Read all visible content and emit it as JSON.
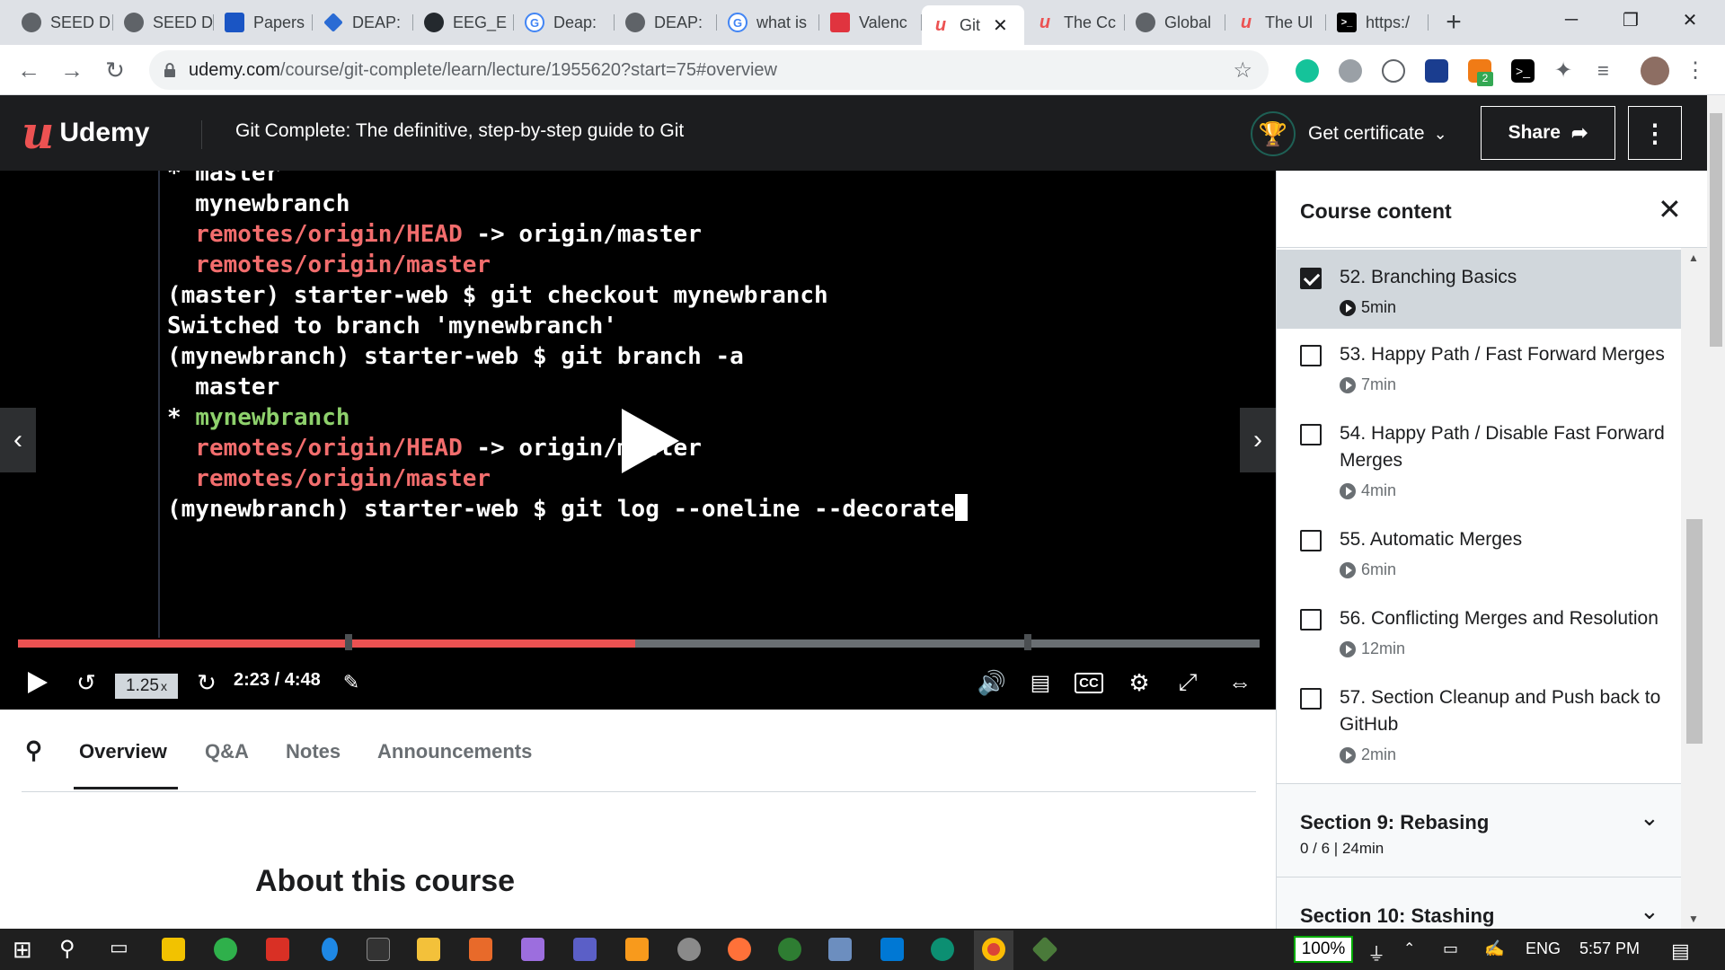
{
  "browser": {
    "tabs": [
      {
        "label": "SEED D",
        "icon": "globe-icon"
      },
      {
        "label": "SEED D",
        "icon": "globe-icon"
      },
      {
        "label": "Papers",
        "icon": "papers-icon"
      },
      {
        "label": "DEAP:",
        "icon": "deap-icon"
      },
      {
        "label": "EEG_E",
        "icon": "github-icon"
      },
      {
        "label": "Deap:",
        "icon": "google-icon"
      },
      {
        "label": "DEAP:",
        "icon": "globe-icon"
      },
      {
        "label": "what is",
        "icon": "google-icon"
      },
      {
        "label": "Valenc",
        "icon": "share-icon"
      },
      {
        "label": "Git",
        "icon": "udemy-icon",
        "active": true
      },
      {
        "label": "The Cc",
        "icon": "udemy-icon"
      },
      {
        "label": "Global",
        "icon": "globe-icon"
      },
      {
        "label": "The Ul",
        "icon": "udemy-icon"
      },
      {
        "label": "https:/",
        "icon": "terminal-icon"
      }
    ],
    "new_tab": "+",
    "url_host": "udemy.com",
    "url_path": "/course/git-complete/learn/lecture/1955620?start=75#overview",
    "extension_badge": "2"
  },
  "header": {
    "logo_letter": "u",
    "logo_word": "Udemy",
    "course_title": "Git Complete: The definitive, step-by-step guide to Git",
    "get_certificate": "Get certificate",
    "share": "Share"
  },
  "video": {
    "terminal_lines": [
      {
        "text": "* master",
        "style": "white",
        "partial": true
      },
      {
        "text": "  mynewbranch",
        "style": "white"
      },
      {
        "parts": [
          {
            "t": "  remotes/origin/HEAD",
            "c": "red"
          },
          {
            "t": " -> origin/master",
            "c": "white"
          }
        ]
      },
      {
        "text": "  remotes/origin/master",
        "style": "red"
      },
      {
        "text": "(master) starter-web $ git checkout mynewbranch",
        "style": "white"
      },
      {
        "text": "Switched to branch 'mynewbranch'",
        "style": "white"
      },
      {
        "text": "(mynewbranch) starter-web $ git branch -a",
        "style": "white"
      },
      {
        "text": "  master",
        "style": "white"
      },
      {
        "parts": [
          {
            "t": "* ",
            "c": "white"
          },
          {
            "t": "mynewbranch",
            "c": "green"
          }
        ]
      },
      {
        "parts": [
          {
            "t": "  remotes/origin/HEAD",
            "c": "red"
          },
          {
            "t": " -> origin/master",
            "c": "white"
          }
        ]
      },
      {
        "text": "  remotes/origin/master",
        "style": "red"
      },
      {
        "text": "(mynewbranch) starter-web $ git log --oneline --decorate",
        "style": "white",
        "cursor": true
      }
    ],
    "playback_rate": "1.25",
    "rate_suffix": "x",
    "current_time": "2:23",
    "duration": "4:48",
    "progress_fraction": 0.497,
    "cc_label": "CC"
  },
  "info_tabs": {
    "overview": "Overview",
    "qa": "Q&A",
    "notes": "Notes",
    "announcements": "Announcements",
    "about_heading": "About this course"
  },
  "sidebar": {
    "title": "Course content",
    "lessons": [
      {
        "title": "52. Branching Basics",
        "duration": "5min",
        "checked": true,
        "current": true
      },
      {
        "title": "53. Happy Path / Fast Forward Merges",
        "duration": "7min",
        "checked": false
      },
      {
        "title": "54. Happy Path / Disable Fast Forward Merges",
        "duration": "4min",
        "checked": false
      },
      {
        "title": "55. Automatic Merges",
        "duration": "6min",
        "checked": false
      },
      {
        "title": "56. Conflicting Merges and Resolution",
        "duration": "12min",
        "checked": false
      },
      {
        "title": "57. Section Cleanup and Push back to GitHub",
        "duration": "2min",
        "checked": false
      }
    ],
    "sections": [
      {
        "title": "Section 9: Rebasing",
        "progress": "0 / 6 | 24min"
      },
      {
        "title": "Section 10: Stashing",
        "progress": ""
      }
    ]
  },
  "taskbar": {
    "zoom": "100%",
    "language": "ENG",
    "time": "5:57 PM"
  },
  "colors": {
    "udemy_red": "#ec5252",
    "header_bg": "#1c1d1f",
    "terminal_red": "#f26d6d",
    "terminal_green": "#8ed16c"
  }
}
